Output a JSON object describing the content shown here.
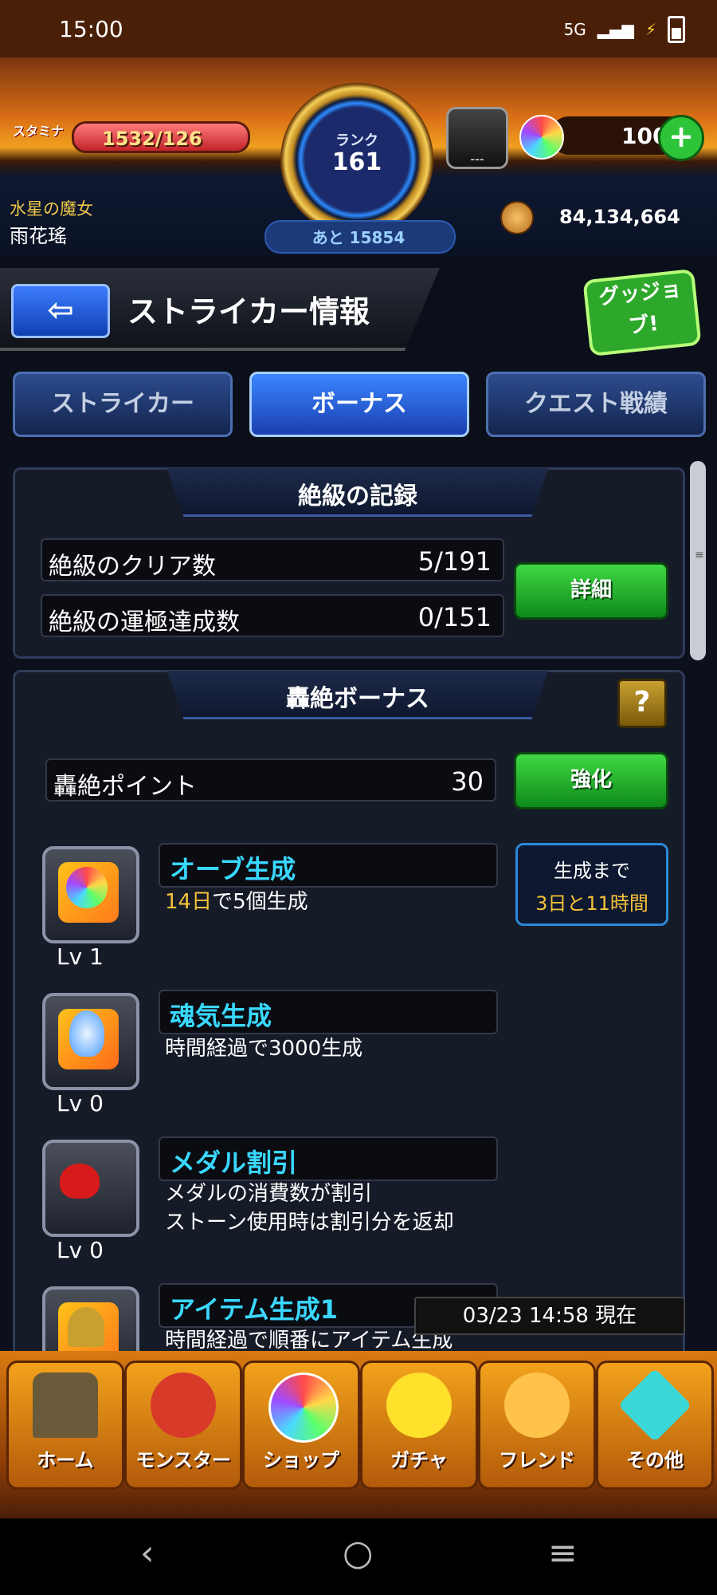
{
  "status": {
    "time": "15:00",
    "network": "5G"
  },
  "header": {
    "stamina_label": "スタミナ",
    "stamina_value": "1532/126",
    "rank_label": "ランク",
    "rank_value": "161",
    "next_label": "あと 15854",
    "machine_label": "---",
    "orb_count": "100",
    "player_title": "水星の魔女",
    "player_name": "雨花瑤",
    "coin_count": "84,134,664"
  },
  "titlebar": {
    "back_icon": "arrow-left",
    "title": "ストライカー情報",
    "goodjob": "グッジョブ!"
  },
  "tabs": [
    {
      "label": "ストライカー",
      "active": false
    },
    {
      "label": "ボーナス",
      "active": true
    },
    {
      "label": "クエスト戦績",
      "active": false
    }
  ],
  "record": {
    "title": "絶級の記録",
    "rows": [
      {
        "label": "絶級のクリア数",
        "value": "5/191"
      },
      {
        "label": "絶級の運極達成数",
        "value": "0/151"
      }
    ],
    "detail_button": "詳細"
  },
  "bonus": {
    "title": "轟絶ボーナス",
    "help": "?",
    "points_label": "轟絶ポイント",
    "points_value": "30",
    "enhance_button": "強化",
    "items": [
      {
        "name": "オーブ生成",
        "desc_hl": "14日",
        "desc_rest": "で5個生成",
        "desc2": "",
        "lv": "Lv  1",
        "icon": "orb-generate-icon"
      },
      {
        "name": "魂気生成",
        "desc_hl": "",
        "desc_rest": "時間経過で3000生成",
        "desc2": "",
        "lv": "Lv  0",
        "icon": "soul-generate-icon"
      },
      {
        "name": "メダル割引",
        "desc_hl": "",
        "desc_rest": "メダルの消費数が割引",
        "desc2": "ストーン使用時は割引分を返却",
        "lv": "Lv  0",
        "icon": "medal-discount-icon"
      },
      {
        "name": "アイテム生成1",
        "desc_hl": "",
        "desc_rest": "時間経過で順番にアイテム生成",
        "desc2": "",
        "lv": "",
        "icon": "item-generate-icon"
      }
    ],
    "timer_label": "生成まで",
    "timer_value": "3日と11時間"
  },
  "timestamp": "03/23 14:58 現在",
  "nav": [
    {
      "label": "ホーム",
      "icon": "home-icon",
      "color": "#6a5a3a"
    },
    {
      "label": "モンスター",
      "icon": "monster-icon",
      "color": "#d83a2a"
    },
    {
      "label": "ショップ",
      "icon": "shop-orb-icon",
      "color": "#4ad8ff"
    },
    {
      "label": "ガチャ",
      "icon": "gacha-icon",
      "color": "#ffe02a"
    },
    {
      "label": "フレンド",
      "icon": "friend-icon",
      "color": "#ffc24a"
    },
    {
      "label": "その他",
      "icon": "other-icon",
      "color": "#3ad8d8"
    }
  ],
  "system_nav": {
    "back": "‹",
    "home": "○",
    "menu": "≡"
  }
}
